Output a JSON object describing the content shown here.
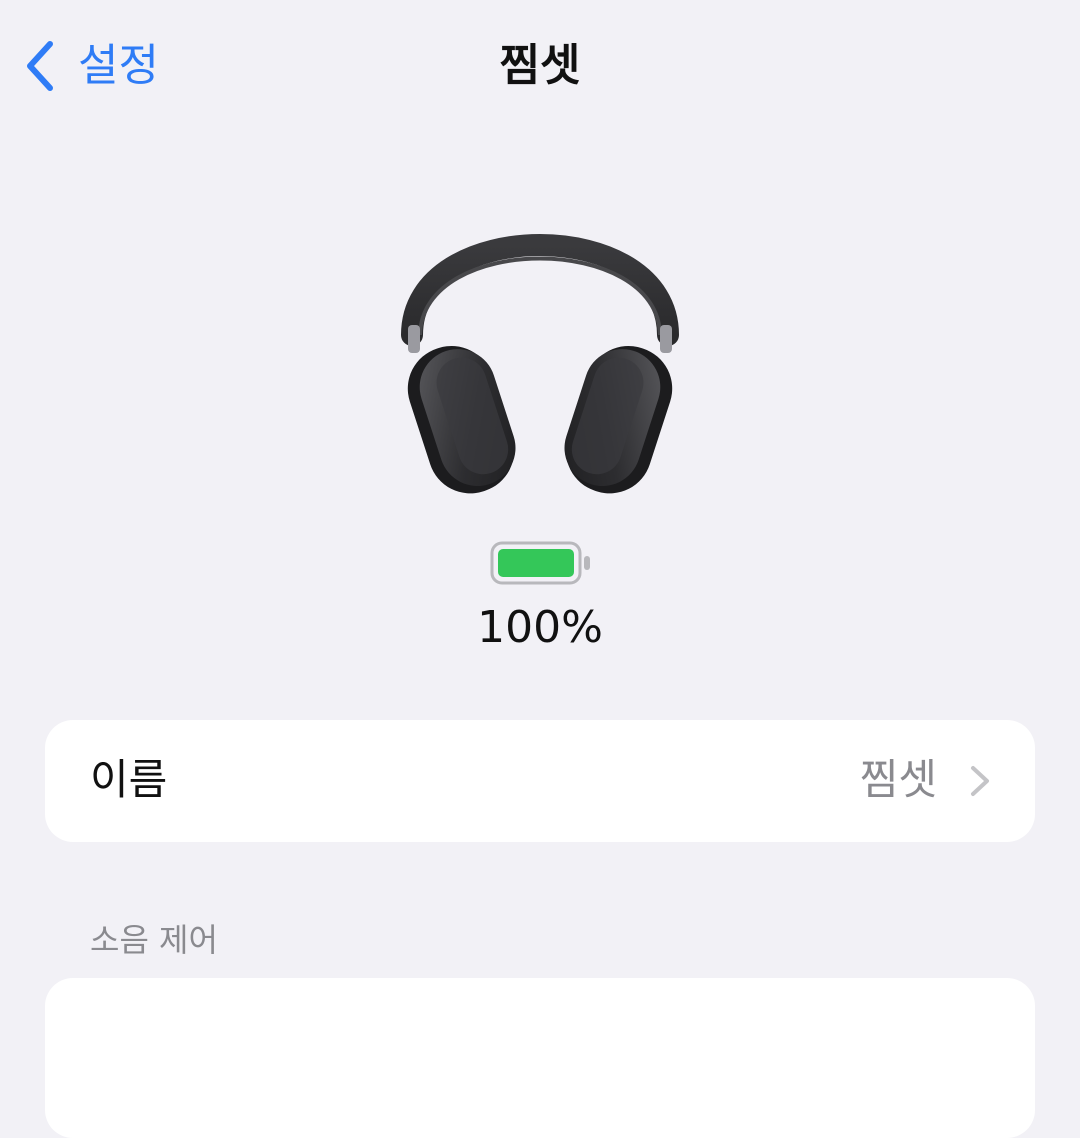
{
  "nav": {
    "back_label": "설정",
    "title": "찜셋"
  },
  "device": {
    "image_icon": "headphones-image",
    "battery_icon": "battery-icon",
    "battery_level": 1.0,
    "battery_text": "100%",
    "battery_color": "#34c759"
  },
  "settings": {
    "name_label": "이름",
    "name_value": "찜셋",
    "noise_control_header": "소음 제어"
  },
  "colors": {
    "accent": "#2f7cf6",
    "background": "#f2f1f6",
    "card": "#ffffff",
    "secondary_text": "#8a8a8f"
  }
}
